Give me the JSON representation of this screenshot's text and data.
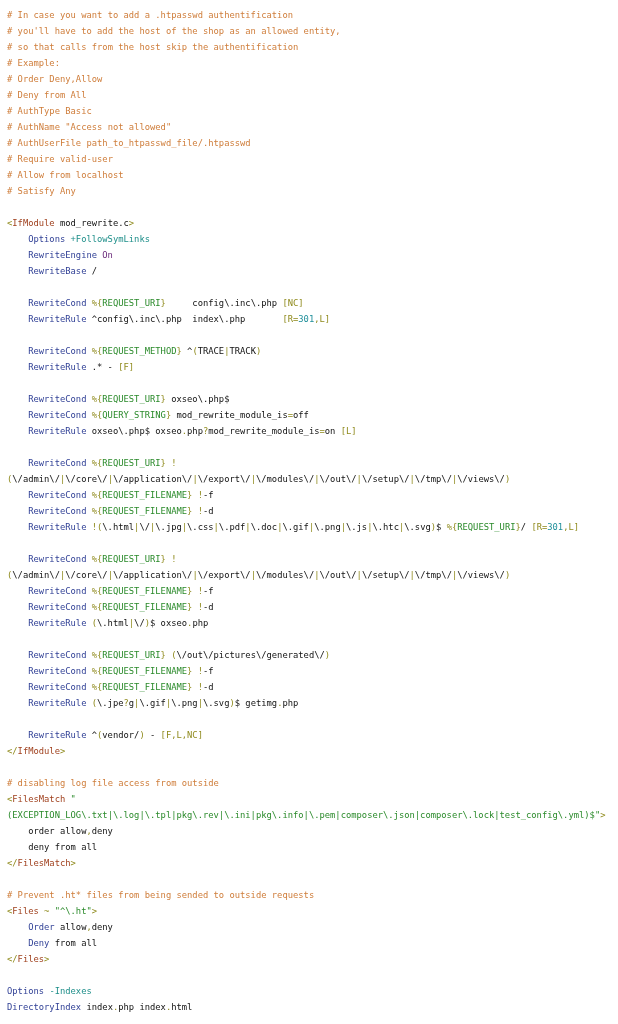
{
  "code_blocks": [
    {
      "lines": [
        {
          "indented": false,
          "tokens": [
            {
              "kind": "comment",
              "text": "# In case you want to add a .htpasswd authentification"
            }
          ]
        },
        {
          "indented": false,
          "tokens": [
            {
              "kind": "comment",
              "text": "# you'll have to add the host of the shop as an allowed entity,"
            }
          ]
        },
        {
          "indented": false,
          "tokens": [
            {
              "kind": "comment",
              "text": "# so that calls from the host skip the authentification"
            }
          ]
        },
        {
          "indented": false,
          "tokens": [
            {
              "kind": "comment",
              "text": "# Example:"
            }
          ]
        },
        {
          "indented": false,
          "tokens": [
            {
              "kind": "comment",
              "text": "# Order Deny,Allow"
            }
          ]
        },
        {
          "indented": false,
          "tokens": [
            {
              "kind": "comment",
              "text": "# Deny from All"
            }
          ]
        },
        {
          "indented": false,
          "tokens": [
            {
              "kind": "comment",
              "text": "# AuthType Basic"
            }
          ]
        },
        {
          "indented": false,
          "tokens": [
            {
              "kind": "comment",
              "text": "# AuthName \"Access not allowed\""
            }
          ]
        },
        {
          "indented": false,
          "tokens": [
            {
              "kind": "comment",
              "text": "# AuthUserFile path_to_htpasswd_file/.htpasswd"
            }
          ]
        },
        {
          "indented": false,
          "tokens": [
            {
              "kind": "comment",
              "text": "# Require valid-user"
            }
          ]
        },
        {
          "indented": false,
          "tokens": [
            {
              "kind": "comment",
              "text": "# Allow from localhost"
            }
          ]
        },
        {
          "indented": false,
          "tokens": [
            {
              "kind": "comment",
              "text": "# Satisfy Any"
            }
          ]
        }
      ]
    },
    {
      "lines": [
        {
          "indented": false,
          "tokens": [
            {
              "kind": "punct",
              "text": "<"
            },
            {
              "kind": "tag",
              "text": "IfModule"
            },
            {
              "kind": "text",
              "text": " mod_rewrite.c"
            },
            {
              "kind": "punct",
              "text": ">"
            }
          ]
        },
        {
          "indented": true,
          "tokens": [
            {
              "kind": "directive",
              "text": "Options "
            },
            {
              "kind": "option",
              "text": "+FollowSymLinks"
            }
          ]
        },
        {
          "indented": true,
          "tokens": [
            {
              "kind": "directive",
              "text": "RewriteEngine "
            },
            {
              "kind": "keyword",
              "text": "On"
            }
          ]
        },
        {
          "indented": true,
          "tokens": [
            {
              "kind": "directive",
              "text": "RewriteBase"
            },
            {
              "kind": "text",
              "text": " /"
            }
          ]
        }
      ]
    },
    {
      "lines": [
        {
          "indented": true,
          "tokens": [
            {
              "kind": "directive",
              "text": "RewriteCond "
            },
            {
              "kind": "punct",
              "text": "%{"
            },
            {
              "kind": "variable",
              "text": "REQUEST_URI"
            },
            {
              "kind": "punct",
              "text": "}"
            },
            {
              "kind": "text",
              "text": "     config\\.inc\\.php "
            },
            {
              "kind": "punct",
              "text": "[NC]"
            }
          ]
        },
        {
          "indented": true,
          "tokens": [
            {
              "kind": "directive",
              "text": "RewriteRule"
            },
            {
              "kind": "text",
              "text": " ^config\\.inc\\.php  index\\.php       "
            },
            {
              "kind": "punct",
              "text": "[R="
            },
            {
              "kind": "number",
              "text": "301"
            },
            {
              "kind": "punct",
              "text": ",L]"
            }
          ]
        }
      ]
    },
    {
      "lines": [
        {
          "indented": true,
          "tokens": [
            {
              "kind": "directive",
              "text": "RewriteCond "
            },
            {
              "kind": "punct",
              "text": "%{"
            },
            {
              "kind": "variable",
              "text": "REQUEST_METHOD"
            },
            {
              "kind": "punct",
              "text": "}"
            },
            {
              "kind": "text",
              "text": " ^"
            },
            {
              "kind": "punct",
              "text": "("
            },
            {
              "kind": "text",
              "text": "TRACE"
            },
            {
              "kind": "punct",
              "text": "|"
            },
            {
              "kind": "text",
              "text": "TRACK"
            },
            {
              "kind": "punct",
              "text": ")"
            }
          ]
        },
        {
          "indented": true,
          "tokens": [
            {
              "kind": "directive",
              "text": "RewriteRule"
            },
            {
              "kind": "text",
              "text": " .* - "
            },
            {
              "kind": "punct",
              "text": "[F]"
            }
          ]
        }
      ]
    },
    {
      "lines": [
        {
          "indented": true,
          "tokens": [
            {
              "kind": "directive",
              "text": "RewriteCond "
            },
            {
              "kind": "punct",
              "text": "%{"
            },
            {
              "kind": "variable",
              "text": "REQUEST_URI"
            },
            {
              "kind": "punct",
              "text": "}"
            },
            {
              "kind": "text",
              "text": " oxseo\\.php$"
            }
          ]
        },
        {
          "indented": true,
          "tokens": [
            {
              "kind": "directive",
              "text": "RewriteCond "
            },
            {
              "kind": "punct",
              "text": "%{"
            },
            {
              "kind": "variable",
              "text": "QUERY_STRING"
            },
            {
              "kind": "punct",
              "text": "}"
            },
            {
              "kind": "text",
              "text": " mod_rewrite_module_is"
            },
            {
              "kind": "punct",
              "text": "="
            },
            {
              "kind": "text",
              "text": "off"
            }
          ]
        },
        {
          "indented": true,
          "tokens": [
            {
              "kind": "directive",
              "text": "RewriteRule"
            },
            {
              "kind": "text",
              "text": " oxseo\\.php$ oxseo"
            },
            {
              "kind": "punct",
              "text": "."
            },
            {
              "kind": "text",
              "text": "php"
            },
            {
              "kind": "punct",
              "text": "?"
            },
            {
              "kind": "text",
              "text": "mod_rewrite_module_is"
            },
            {
              "kind": "punct",
              "text": "="
            },
            {
              "kind": "text",
              "text": "on "
            },
            {
              "kind": "punct",
              "text": "[L]"
            }
          ]
        }
      ]
    },
    {
      "lines": [
        {
          "indented": true,
          "tokens": [
            {
              "kind": "directive",
              "text": "RewriteCond "
            },
            {
              "kind": "punct",
              "text": "%{"
            },
            {
              "kind": "variable",
              "text": "REQUEST_URI"
            },
            {
              "kind": "punct",
              "text": "} !"
            }
          ]
        },
        {
          "indented": false,
          "tokens": [
            {
              "kind": "punct",
              "text": "("
            },
            {
              "kind": "text",
              "text": "\\/admin\\/"
            },
            {
              "kind": "punct",
              "text": "|"
            },
            {
              "kind": "text",
              "text": "\\/core\\/"
            },
            {
              "kind": "punct",
              "text": "|"
            },
            {
              "kind": "text",
              "text": "\\/application\\/"
            },
            {
              "kind": "punct",
              "text": "|"
            },
            {
              "kind": "text",
              "text": "\\/export\\/"
            },
            {
              "kind": "punct",
              "text": "|"
            },
            {
              "kind": "text",
              "text": "\\/modules\\/"
            },
            {
              "kind": "punct",
              "text": "|"
            },
            {
              "kind": "text",
              "text": "\\/out\\/"
            },
            {
              "kind": "punct",
              "text": "|"
            },
            {
              "kind": "text",
              "text": "\\/setup\\/"
            },
            {
              "kind": "punct",
              "text": "|"
            },
            {
              "kind": "text",
              "text": "\\/tmp\\/"
            },
            {
              "kind": "punct",
              "text": "|"
            },
            {
              "kind": "text",
              "text": "\\/views\\/"
            },
            {
              "kind": "punct",
              "text": ")"
            }
          ]
        },
        {
          "indented": true,
          "tokens": [
            {
              "kind": "directive",
              "text": "RewriteCond "
            },
            {
              "kind": "punct",
              "text": "%{"
            },
            {
              "kind": "variable",
              "text": "REQUEST_FILENAME"
            },
            {
              "kind": "punct",
              "text": "} !"
            },
            {
              "kind": "text",
              "text": "-f"
            }
          ]
        },
        {
          "indented": true,
          "tokens": [
            {
              "kind": "directive",
              "text": "RewriteCond "
            },
            {
              "kind": "punct",
              "text": "%{"
            },
            {
              "kind": "variable",
              "text": "REQUEST_FILENAME"
            },
            {
              "kind": "punct",
              "text": "} !"
            },
            {
              "kind": "text",
              "text": "-d"
            }
          ]
        },
        {
          "indented": true,
          "tokens": [
            {
              "kind": "directive",
              "text": "RewriteRule "
            },
            {
              "kind": "punct",
              "text": "!("
            },
            {
              "kind": "text",
              "text": "\\.html"
            },
            {
              "kind": "punct",
              "text": "|"
            },
            {
              "kind": "text",
              "text": "\\/"
            },
            {
              "kind": "punct",
              "text": "|"
            },
            {
              "kind": "text",
              "text": "\\.jpg"
            },
            {
              "kind": "punct",
              "text": "|"
            },
            {
              "kind": "text",
              "text": "\\.css"
            },
            {
              "kind": "punct",
              "text": "|"
            },
            {
              "kind": "text",
              "text": "\\.pdf"
            },
            {
              "kind": "punct",
              "text": "|"
            },
            {
              "kind": "text",
              "text": "\\.doc"
            },
            {
              "kind": "punct",
              "text": "|"
            },
            {
              "kind": "text",
              "text": "\\.gif"
            },
            {
              "kind": "punct",
              "text": "|"
            },
            {
              "kind": "text",
              "text": "\\.png"
            },
            {
              "kind": "punct",
              "text": "|"
            },
            {
              "kind": "text",
              "text": "\\.js"
            },
            {
              "kind": "punct",
              "text": "|"
            },
            {
              "kind": "text",
              "text": "\\.htc"
            },
            {
              "kind": "punct",
              "text": "|"
            },
            {
              "kind": "text",
              "text": "\\.svg"
            },
            {
              "kind": "punct",
              "text": ")"
            },
            {
              "kind": "text",
              "text": "$ "
            },
            {
              "kind": "punct",
              "text": "%{"
            },
            {
              "kind": "variable",
              "text": "REQUEST_URI"
            },
            {
              "kind": "punct",
              "text": "}"
            },
            {
              "kind": "text",
              "text": "/ "
            },
            {
              "kind": "punct",
              "text": "[R="
            },
            {
              "kind": "number",
              "text": "301"
            },
            {
              "kind": "punct",
              "text": ",L]"
            }
          ]
        }
      ]
    },
    {
      "lines": [
        {
          "indented": true,
          "tokens": [
            {
              "kind": "directive",
              "text": "RewriteCond "
            },
            {
              "kind": "punct",
              "text": "%{"
            },
            {
              "kind": "variable",
              "text": "REQUEST_URI"
            },
            {
              "kind": "punct",
              "text": "} !"
            }
          ]
        },
        {
          "indented": false,
          "tokens": [
            {
              "kind": "punct",
              "text": "("
            },
            {
              "kind": "text",
              "text": "\\/admin\\/"
            },
            {
              "kind": "punct",
              "text": "|"
            },
            {
              "kind": "text",
              "text": "\\/core\\/"
            },
            {
              "kind": "punct",
              "text": "|"
            },
            {
              "kind": "text",
              "text": "\\/application\\/"
            },
            {
              "kind": "punct",
              "text": "|"
            },
            {
              "kind": "text",
              "text": "\\/export\\/"
            },
            {
              "kind": "punct",
              "text": "|"
            },
            {
              "kind": "text",
              "text": "\\/modules\\/"
            },
            {
              "kind": "punct",
              "text": "|"
            },
            {
              "kind": "text",
              "text": "\\/out\\/"
            },
            {
              "kind": "punct",
              "text": "|"
            },
            {
              "kind": "text",
              "text": "\\/setup\\/"
            },
            {
              "kind": "punct",
              "text": "|"
            },
            {
              "kind": "text",
              "text": "\\/tmp\\/"
            },
            {
              "kind": "punct",
              "text": "|"
            },
            {
              "kind": "text",
              "text": "\\/views\\/"
            },
            {
              "kind": "punct",
              "text": ")"
            }
          ]
        },
        {
          "indented": true,
          "tokens": [
            {
              "kind": "directive",
              "text": "RewriteCond "
            },
            {
              "kind": "punct",
              "text": "%{"
            },
            {
              "kind": "variable",
              "text": "REQUEST_FILENAME"
            },
            {
              "kind": "punct",
              "text": "} !"
            },
            {
              "kind": "text",
              "text": "-f"
            }
          ]
        },
        {
          "indented": true,
          "tokens": [
            {
              "kind": "directive",
              "text": "RewriteCond "
            },
            {
              "kind": "punct",
              "text": "%{"
            },
            {
              "kind": "variable",
              "text": "REQUEST_FILENAME"
            },
            {
              "kind": "punct",
              "text": "} !"
            },
            {
              "kind": "text",
              "text": "-d"
            }
          ]
        },
        {
          "indented": true,
          "tokens": [
            {
              "kind": "directive",
              "text": "RewriteRule "
            },
            {
              "kind": "punct",
              "text": "("
            },
            {
              "kind": "text",
              "text": "\\.html"
            },
            {
              "kind": "punct",
              "text": "|"
            },
            {
              "kind": "text",
              "text": "\\/"
            },
            {
              "kind": "punct",
              "text": ")"
            },
            {
              "kind": "text",
              "text": "$ oxseo"
            },
            {
              "kind": "punct",
              "text": "."
            },
            {
              "kind": "text",
              "text": "php"
            }
          ]
        }
      ]
    },
    {
      "lines": [
        {
          "indented": true,
          "tokens": [
            {
              "kind": "directive",
              "text": "RewriteCond "
            },
            {
              "kind": "punct",
              "text": "%{"
            },
            {
              "kind": "variable",
              "text": "REQUEST_URI"
            },
            {
              "kind": "punct",
              "text": "} ("
            },
            {
              "kind": "text",
              "text": "\\/out\\/pictures\\/generated\\/"
            },
            {
              "kind": "punct",
              "text": ")"
            }
          ]
        },
        {
          "indented": true,
          "tokens": [
            {
              "kind": "directive",
              "text": "RewriteCond "
            },
            {
              "kind": "punct",
              "text": "%{"
            },
            {
              "kind": "variable",
              "text": "REQUEST_FILENAME"
            },
            {
              "kind": "punct",
              "text": "} !"
            },
            {
              "kind": "text",
              "text": "-f"
            }
          ]
        },
        {
          "indented": true,
          "tokens": [
            {
              "kind": "directive",
              "text": "RewriteCond "
            },
            {
              "kind": "punct",
              "text": "%{"
            },
            {
              "kind": "variable",
              "text": "REQUEST_FILENAME"
            },
            {
              "kind": "punct",
              "text": "} !"
            },
            {
              "kind": "text",
              "text": "-d"
            }
          ]
        },
        {
          "indented": true,
          "tokens": [
            {
              "kind": "directive",
              "text": "RewriteRule "
            },
            {
              "kind": "punct",
              "text": "("
            },
            {
              "kind": "text",
              "text": "\\.jpe"
            },
            {
              "kind": "punct",
              "text": "?"
            },
            {
              "kind": "text",
              "text": "g"
            },
            {
              "kind": "punct",
              "text": "|"
            },
            {
              "kind": "text",
              "text": "\\.gif"
            },
            {
              "kind": "punct",
              "text": "|"
            },
            {
              "kind": "text",
              "text": "\\.png"
            },
            {
              "kind": "punct",
              "text": "|"
            },
            {
              "kind": "text",
              "text": "\\.svg"
            },
            {
              "kind": "punct",
              "text": ")"
            },
            {
              "kind": "text",
              "text": "$ getimg"
            },
            {
              "kind": "punct",
              "text": "."
            },
            {
              "kind": "text",
              "text": "php"
            }
          ]
        }
      ]
    },
    {
      "lines": [
        {
          "indented": true,
          "tokens": [
            {
              "kind": "directive",
              "text": "RewriteRule"
            },
            {
              "kind": "text",
              "text": " ^"
            },
            {
              "kind": "punct",
              "text": "("
            },
            {
              "kind": "text",
              "text": "vendor/"
            },
            {
              "kind": "punct",
              "text": ")"
            },
            {
              "kind": "text",
              "text": " - "
            },
            {
              "kind": "punct",
              "text": "[F,L,NC]"
            }
          ]
        },
        {
          "indented": false,
          "tokens": [
            {
              "kind": "punct",
              "text": "</"
            },
            {
              "kind": "tag",
              "text": "IfModule"
            },
            {
              "kind": "punct",
              "text": ">"
            }
          ]
        }
      ]
    },
    {
      "lines": [
        {
          "indented": false,
          "tokens": [
            {
              "kind": "comment",
              "text": "# disabling log file access from outside"
            }
          ]
        },
        {
          "indented": false,
          "tokens": [
            {
              "kind": "punct",
              "text": "<"
            },
            {
              "kind": "tag",
              "text": "FilesMatch "
            },
            {
              "kind": "string",
              "text": "\""
            }
          ]
        },
        {
          "indented": false,
          "tokens": [
            {
              "kind": "string",
              "text": "(EXCEPTION_LOG\\.txt|\\.log|\\.tpl|pkg\\.rev|\\.ini|pkg\\.info|\\.pem|composer\\.json|composer\\.lock|test_config\\.yml)$\""
            },
            {
              "kind": "punct",
              "text": ">"
            }
          ]
        },
        {
          "indented": true,
          "tokens": [
            {
              "kind": "text",
              "text": "order allow"
            },
            {
              "kind": "punct",
              "text": ","
            },
            {
              "kind": "text",
              "text": "deny"
            }
          ]
        },
        {
          "indented": true,
          "tokens": [
            {
              "kind": "text",
              "text": "deny from all"
            }
          ]
        },
        {
          "indented": false,
          "tokens": [
            {
              "kind": "punct",
              "text": "</"
            },
            {
              "kind": "tag",
              "text": "FilesMatch"
            },
            {
              "kind": "punct",
              "text": ">"
            }
          ]
        }
      ]
    },
    {
      "lines": [
        {
          "indented": false,
          "tokens": [
            {
              "kind": "comment",
              "text": "# Prevent .ht* files from being sended to outside requests"
            }
          ]
        },
        {
          "indented": false,
          "tokens": [
            {
              "kind": "punct",
              "text": "<"
            },
            {
              "kind": "tag",
              "text": "Files "
            },
            {
              "kind": "punct",
              "text": "~ "
            },
            {
              "kind": "string",
              "text": "\"^\\.ht\""
            },
            {
              "kind": "punct",
              "text": ">"
            }
          ]
        },
        {
          "indented": true,
          "tokens": [
            {
              "kind": "directive",
              "text": "Order"
            },
            {
              "kind": "text",
              "text": " allow"
            },
            {
              "kind": "punct",
              "text": ","
            },
            {
              "kind": "text",
              "text": "deny"
            }
          ]
        },
        {
          "indented": true,
          "tokens": [
            {
              "kind": "directive",
              "text": "Deny"
            },
            {
              "kind": "text",
              "text": " from all"
            }
          ]
        },
        {
          "indented": false,
          "tokens": [
            {
              "kind": "punct",
              "text": "</"
            },
            {
              "kind": "tag",
              "text": "Files"
            },
            {
              "kind": "punct",
              "text": ">"
            }
          ]
        }
      ]
    },
    {
      "lines": [
        {
          "indented": false,
          "tokens": [
            {
              "kind": "directive",
              "text": "Options "
            },
            {
              "kind": "option",
              "text": "-Indexes"
            }
          ]
        },
        {
          "indented": false,
          "tokens": [
            {
              "kind": "directive",
              "text": "DirectoryIndex"
            },
            {
              "kind": "text",
              "text": " index"
            },
            {
              "kind": "punct",
              "text": "."
            },
            {
              "kind": "text",
              "text": "php index"
            },
            {
              "kind": "punct",
              "text": "."
            },
            {
              "kind": "text",
              "text": "html"
            }
          ]
        }
      ]
    }
  ]
}
